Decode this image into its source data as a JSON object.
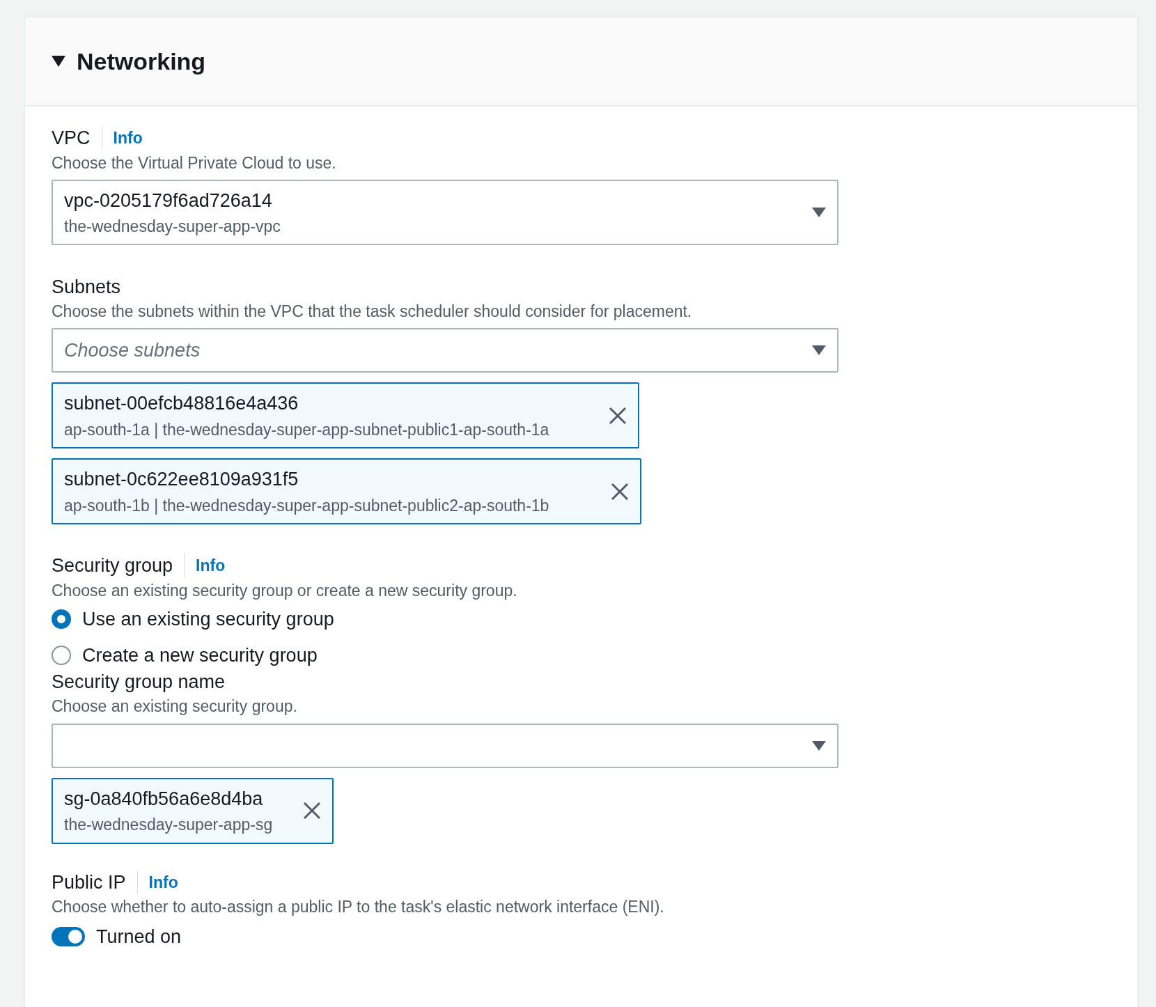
{
  "section": {
    "title": "Networking",
    "expanded": true
  },
  "vpc": {
    "label": "VPC",
    "info": "Info",
    "description": "Choose the Virtual Private Cloud to use.",
    "select": {
      "value": "vpc-0205179f6ad726a14",
      "detail": "the-wednesday-super-app-vpc"
    }
  },
  "subnets": {
    "label": "Subnets",
    "description": "Choose the subnets within the VPC that the task scheduler should consider for placement.",
    "select": {
      "placeholder": "Choose subnets"
    },
    "tokens": [
      {
        "value": "subnet-00efcb48816e4a436",
        "detail": "ap-south-1a | the-wednesday-super-app-subnet-public1-ap-south-1a"
      },
      {
        "value": "subnet-0c622ee8109a931f5",
        "detail": "ap-south-1b | the-wednesday-super-app-subnet-public2-ap-south-1b"
      }
    ]
  },
  "security_group": {
    "label": "Security group",
    "info": "Info",
    "description": "Choose an existing security group or create a new security group.",
    "options": [
      {
        "label": "Use an existing security group",
        "selected": true
      },
      {
        "label": "Create a new security group",
        "selected": false
      }
    ],
    "name_field": {
      "label": "Security group name",
      "description": "Choose an existing security group."
    },
    "tokens": [
      {
        "value": "sg-0a840fb56a6e8d4ba",
        "detail": "the-wednesday-super-app-sg"
      }
    ]
  },
  "public_ip": {
    "label": "Public IP",
    "info": "Info",
    "description": "Choose whether to auto-assign a public IP to the task's elastic network interface (ENI).",
    "toggle": {
      "on": true,
      "label": "Turned on"
    }
  }
}
